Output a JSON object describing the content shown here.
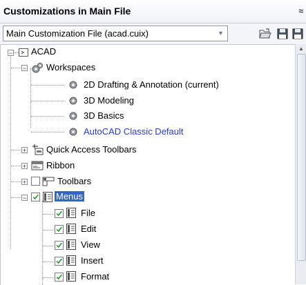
{
  "header": {
    "title": "Customizations in Main File",
    "collapse_glyph": "≈"
  },
  "toolbar": {
    "file_select_value": "Main Customization File (acad.cuix)",
    "open_icon": "open-folder-icon",
    "save_icon": "save-icon",
    "partial_icon": "load-partial-icon"
  },
  "tree": {
    "root": {
      "label": "ACAD",
      "expanded": true
    },
    "workspaces": {
      "label": "Workspaces",
      "items": [
        {
          "label": "2D Drafting & Annotation (current)"
        },
        {
          "label": "3D Modeling"
        },
        {
          "label": "3D Basics"
        },
        {
          "label": "AutoCAD Classic Default",
          "color": "#2a38d6"
        }
      ]
    },
    "quick_access": {
      "label": "Quick Access Toolbars"
    },
    "ribbon": {
      "label": "Ribbon"
    },
    "toolbars": {
      "label": "Toolbars",
      "checked": false
    },
    "menus": {
      "label": "Menus",
      "checked": true,
      "selected": true,
      "items": [
        {
          "label": "File",
          "checked": true
        },
        {
          "label": "Edit",
          "checked": true
        },
        {
          "label": "View",
          "checked": true
        },
        {
          "label": "Insert",
          "checked": true
        },
        {
          "label": "Format",
          "checked": true
        }
      ]
    }
  },
  "colors": {
    "selection": "#3465c8",
    "link": "#2a38d6",
    "check": "#2c9a2c"
  }
}
